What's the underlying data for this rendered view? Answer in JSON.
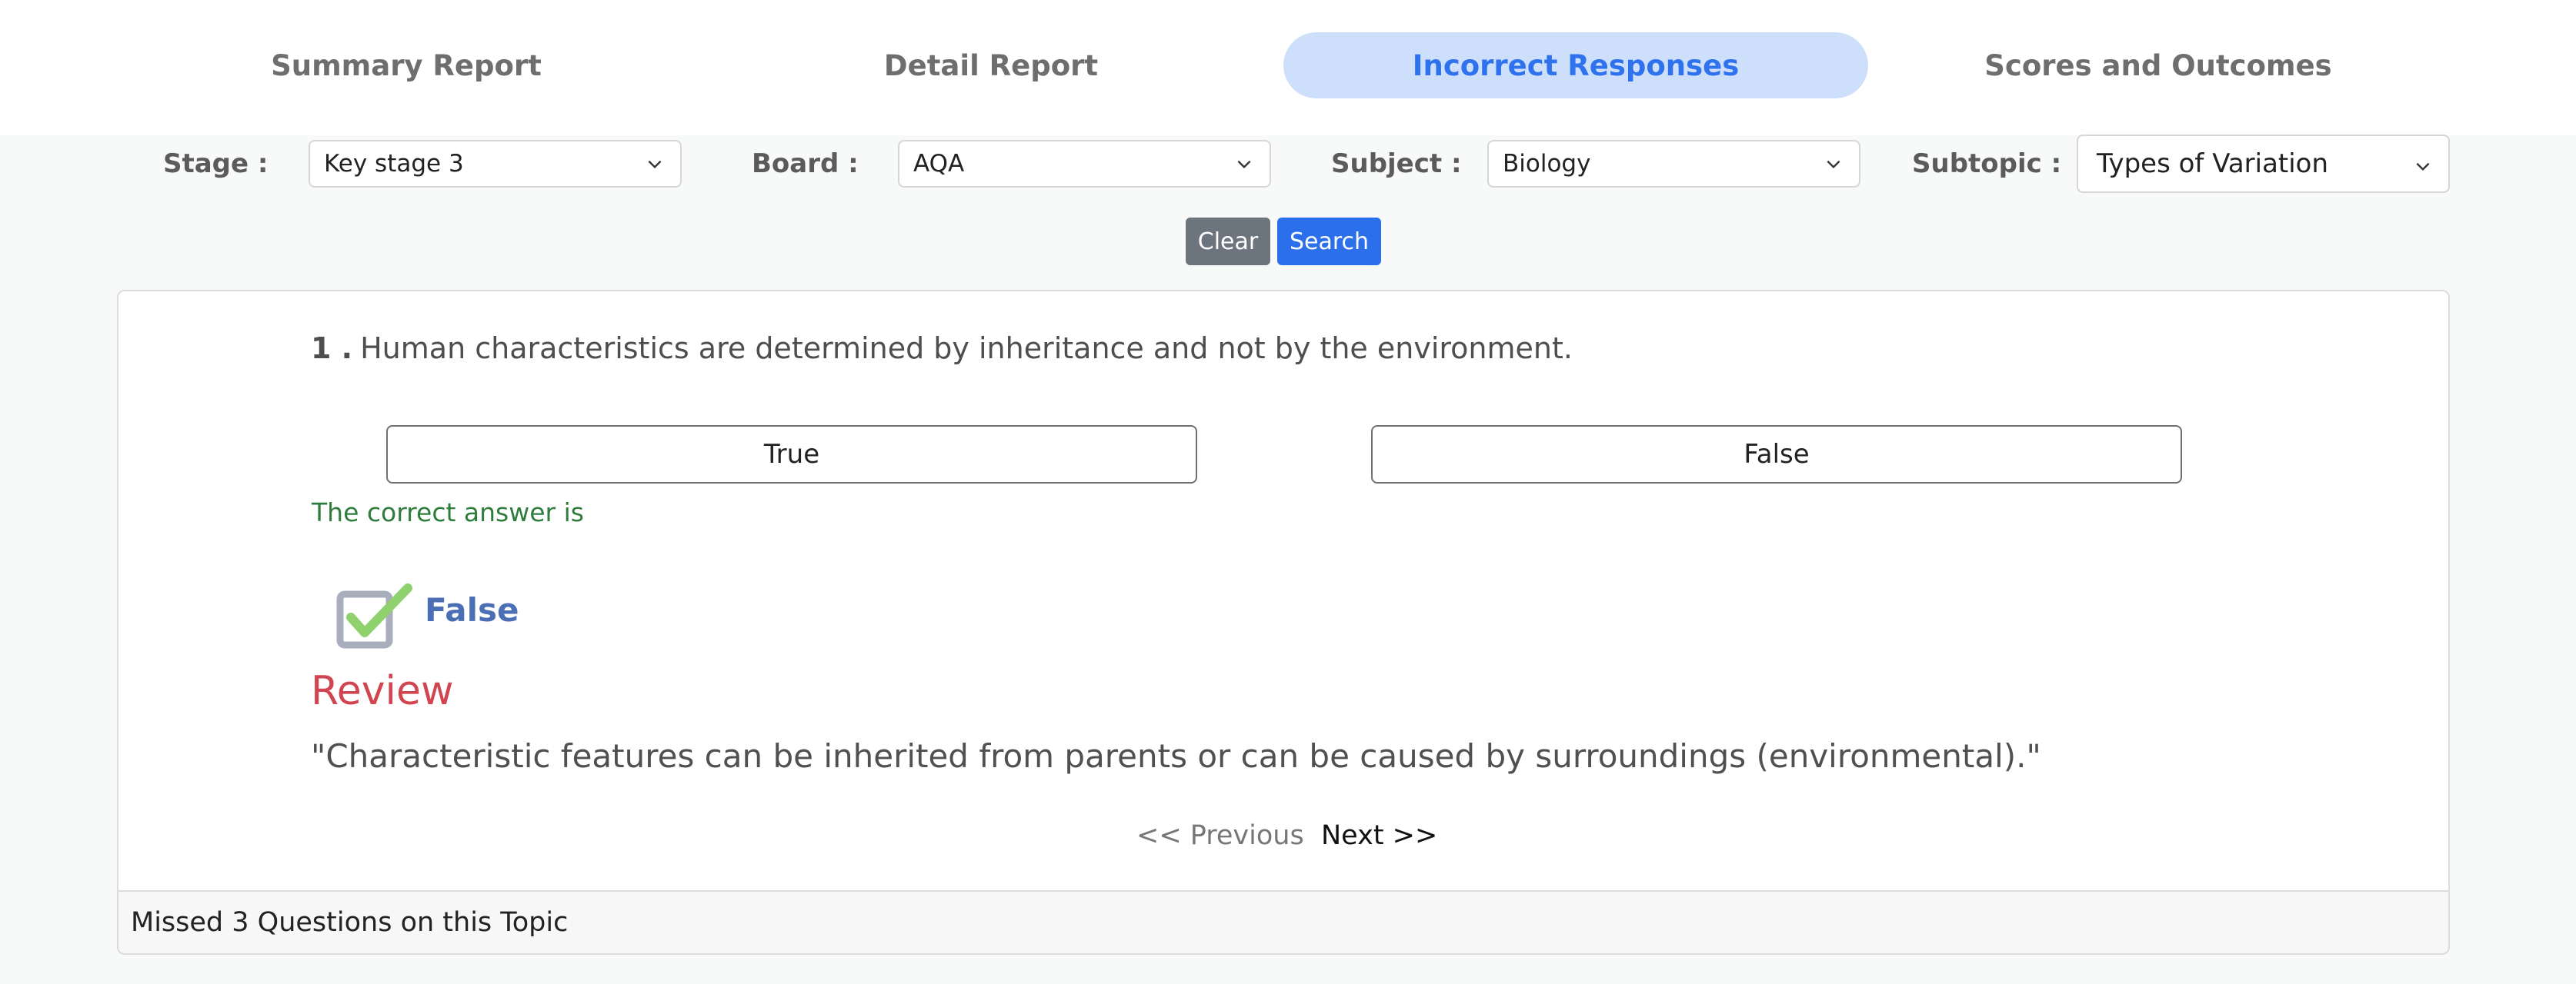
{
  "tabs": [
    {
      "label": "Summary Report",
      "active": false
    },
    {
      "label": "Detail Report",
      "active": false
    },
    {
      "label": "Incorrect Responses",
      "active": true
    },
    {
      "label": "Scores and Outcomes",
      "active": false
    }
  ],
  "filters": {
    "stage": {
      "label": "Stage :",
      "value": "Key stage 3"
    },
    "board": {
      "label": "Board :",
      "value": "AQA"
    },
    "subject": {
      "label": "Subject :",
      "value": "Biology"
    },
    "subtopic": {
      "label": "Subtopic :",
      "value": "Types of Variation"
    }
  },
  "buttons": {
    "clear": "Clear",
    "search": "Search"
  },
  "question": {
    "number": "1 .",
    "text": "Human characteristics are determined by inheritance and not by the environment.",
    "options": [
      "True",
      "False"
    ],
    "correct_label": "The correct answer is",
    "correct_answer": "False",
    "review_title": "Review",
    "review_text": "\"Characteristic features can be inherited from parents or can be caused by surroundings (environmental).\""
  },
  "nav": {
    "previous": "<< Previous",
    "next": "Next >>"
  },
  "footer": "Missed 3 Questions on this Topic",
  "colors": {
    "accent": "#2f72ee",
    "active_tab_bg": "#cddffb",
    "review": "#d04550",
    "correct": "#2e7d3d"
  }
}
